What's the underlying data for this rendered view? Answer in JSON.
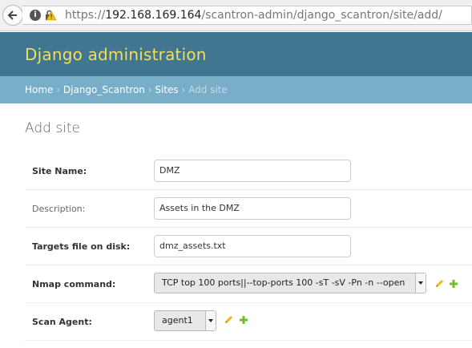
{
  "browser": {
    "url_prefix": "https://",
    "url_host": "192.168.169.164",
    "url_path": "/scantron-admin/django_scantron/site/add/"
  },
  "header": {
    "branding": "Django administration"
  },
  "breadcrumbs": {
    "home": "Home",
    "app": "Django_Scantron",
    "model": "Sites",
    "current": "Add site",
    "separator": "›"
  },
  "page": {
    "title": "Add site"
  },
  "form": {
    "site_name": {
      "label": "Site Name:",
      "value": "DMZ"
    },
    "description": {
      "label": "Description:",
      "value": "Assets in the DMZ"
    },
    "targets_file": {
      "label": "Targets file on disk:",
      "value": "dmz_assets.txt"
    },
    "nmap_command": {
      "label": "Nmap command:",
      "selected": "TCP top 100 ports||--top-ports 100 -sT -sV -Pn -n --open"
    },
    "scan_agent": {
      "label": "Scan Agent:",
      "selected": "agent1"
    }
  },
  "colors": {
    "header_bg": "#417690",
    "branding_text": "#f5dd5d",
    "breadcrumbs_bg": "#79aec8",
    "edit_icon": "#efb80b",
    "add_icon": "#70bf2b"
  },
  "icons": [
    "back-arrow-icon",
    "info-icon",
    "insecure-lock-icon",
    "edit-pencil-icon",
    "add-plus-icon",
    "chevron-down-icon"
  ]
}
